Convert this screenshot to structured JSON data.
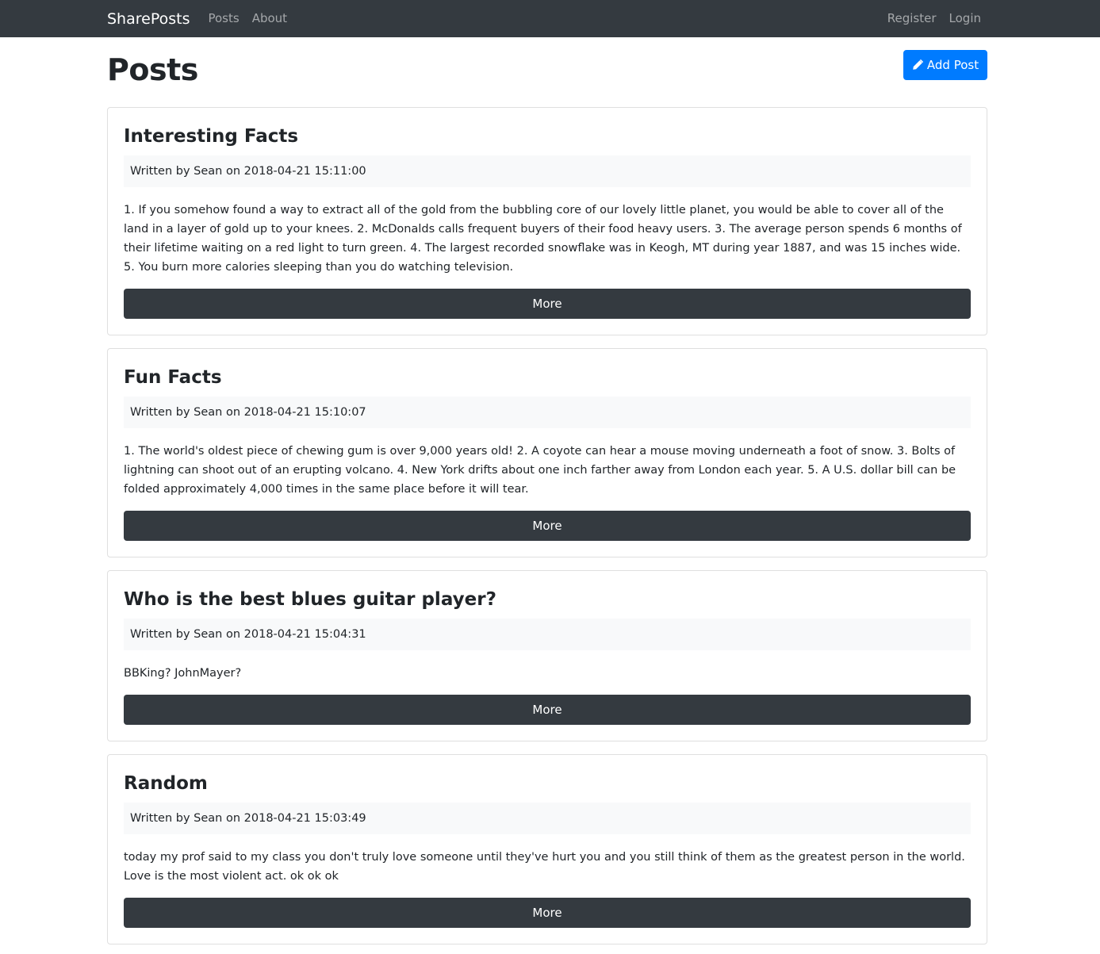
{
  "navbar": {
    "brand": "SharePosts",
    "links": [
      "Posts",
      "About"
    ],
    "right_links": [
      "Register",
      "Login"
    ]
  },
  "page": {
    "title": "Posts",
    "add_button_label": "Add Post",
    "add_button_icon": "pencil-icon"
  },
  "colors": {
    "navbar": "#343a40",
    "primary": "#007bff",
    "dark_button": "#343a40",
    "meta_background": "#f8f9fa"
  },
  "posts": [
    {
      "title": "Interesting Facts",
      "meta": "Written by Sean on 2018-04-21 15:11:00",
      "body": "1. If you somehow found a way to extract all of the gold from the bubbling core of our lovely little planet, you would be able to cover all of the land in a layer of gold up to your knees. 2. McDonalds calls frequent buyers of their food heavy users. 3. The average person spends 6 months of their lifetime waiting on a red light to turn green. 4. The largest recorded snowflake was in Keogh, MT during year 1887, and was 15 inches wide. 5. You burn more calories sleeping than you do watching television.",
      "button_label": "More"
    },
    {
      "title": "Fun Facts",
      "meta": "Written by Sean on 2018-04-21 15:10:07",
      "body": "1. The world's oldest piece of chewing gum is over 9,000 years old! 2. A coyote can hear a mouse moving underneath a foot of snow. 3. Bolts of lightning can shoot out of an erupting volcano. 4. New York drifts about one inch farther away from London each year. 5. A U.S. dollar bill can be folded approximately 4,000 times in the same place before it will tear.",
      "button_label": "More"
    },
    {
      "title": "Who is the best blues guitar player?",
      "meta": "Written by Sean on 2018-04-21 15:04:31",
      "body": "BBKing? JohnMayer?",
      "button_label": "More"
    },
    {
      "title": "Random",
      "meta": "Written by Sean on 2018-04-21 15:03:49",
      "body": "today my prof said to my class you don't truly love someone until they've hurt you and you still think of them as the greatest person in the world. Love is the most violent act. ok ok ok",
      "button_label": "More"
    }
  ]
}
